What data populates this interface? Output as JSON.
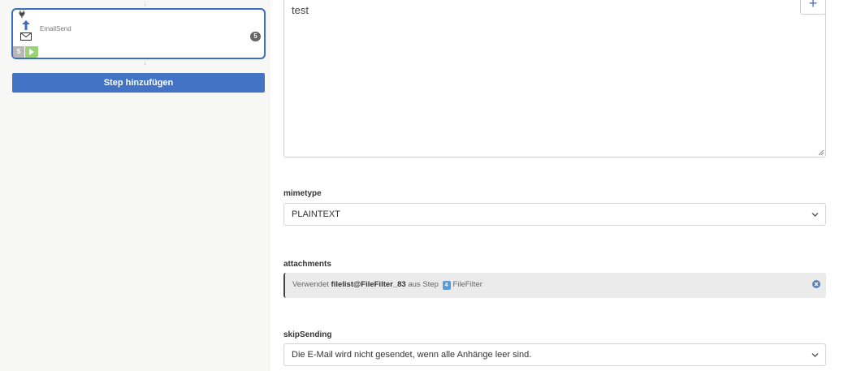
{
  "flow": {
    "step": {
      "name": "EmailSend",
      "count": "5",
      "number": "5"
    },
    "add_step_label": "Step hinzufügen"
  },
  "form": {
    "body_value": "test",
    "plus_label": "+",
    "mimetype": {
      "label": "mimetype",
      "value": "PLAINTEXT"
    },
    "attachments": {
      "label": "attachments",
      "prefix": "Verwendet",
      "variable": "filelist@FileFilter_83",
      "middle": "aus Step",
      "step_number": "4",
      "step_name": "FileFilter"
    },
    "skipSending": {
      "label": "skipSending",
      "value": "Die E-Mail wird nicht gesendet, wenn alle Anhänge leer sind."
    }
  },
  "colors": {
    "accent": "#4273c4",
    "run_green": "#9bd274",
    "badge_blue": "#5b9bd5"
  }
}
